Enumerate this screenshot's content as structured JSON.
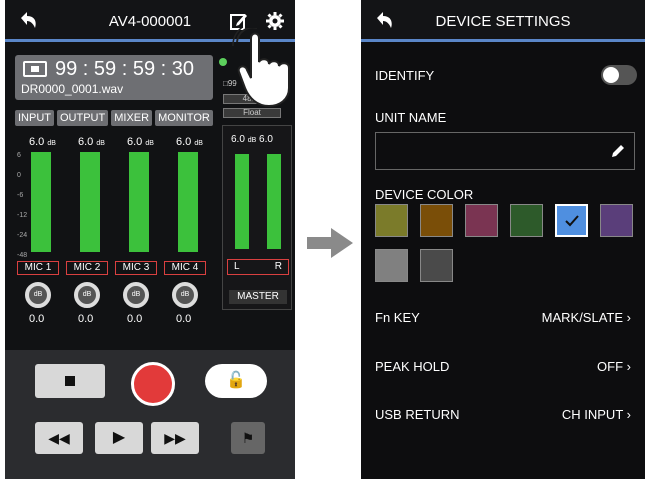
{
  "left": {
    "title": "AV4-000001",
    "timecode": "99 : 59 : 59 : 30",
    "filename": "DR0000_0001.wav",
    "indicator_a": "□99",
    "indicator_b": "48kH",
    "indicator_c": "Float",
    "tabs": [
      "INPUT",
      "OUTPUT",
      "MIXER",
      "MONITOR"
    ],
    "channels": [
      {
        "name": "MIC 1",
        "level": "6.0",
        "unit": "dB",
        "knob": "dB",
        "value": "0.0",
        "fill": 0.7
      },
      {
        "name": "MIC 2",
        "level": "6.0",
        "unit": "dB",
        "knob": "dB",
        "value": "0.0",
        "fill": 0.7
      },
      {
        "name": "MIC 3",
        "level": "6.0",
        "unit": "dB",
        "knob": "dB",
        "value": "0.0",
        "fill": 0.7
      },
      {
        "name": "MIC 4",
        "level": "6.0",
        "unit": "dB",
        "knob": "dB",
        "value": "0.0",
        "fill": 0.7
      }
    ],
    "scale": [
      "6",
      "0",
      "-6",
      "-12",
      "-24",
      "-48"
    ],
    "master": {
      "label": "MASTER",
      "l": "L",
      "r": "R",
      "level_l": "6.0",
      "level_r": "6.0",
      "unit": "dB"
    }
  },
  "right": {
    "title": "DEVICE SETTINGS",
    "identify_label": "IDENTIFY",
    "unit_name_label": "UNIT NAME",
    "unit_name_value": "",
    "device_color_label": "DEVICE COLOR",
    "colors": [
      "#7b7b2a",
      "#7a4e08",
      "#7a3452",
      "#2d5a2a",
      "#4f8fe0",
      "#5a3e7a",
      "#808080",
      "#4a4a4a"
    ],
    "selected_color_index": 4,
    "settings": [
      {
        "label": "Fn KEY",
        "value": "MARK/SLATE"
      },
      {
        "label": "PEAK HOLD",
        "value": "OFF"
      },
      {
        "label": "USB RETURN",
        "value": "CH INPUT"
      }
    ]
  },
  "colors": {
    "accent": "#5a86c8",
    "meter": "#3cc13c",
    "rec": "#e23a3a",
    "channel_border": "#d94040"
  }
}
